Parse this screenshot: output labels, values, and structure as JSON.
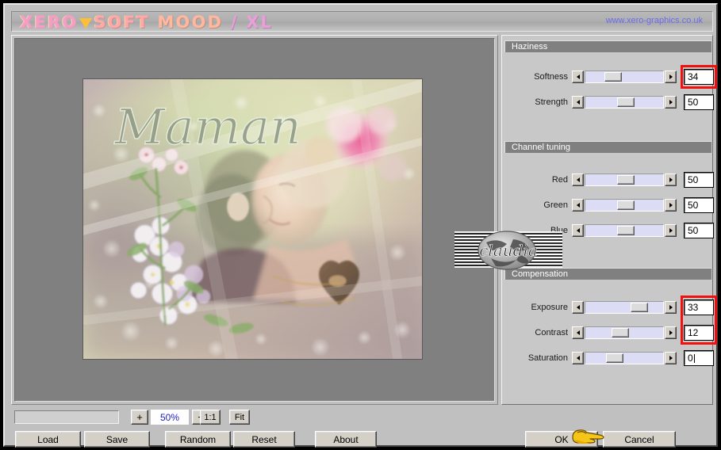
{
  "window": {
    "title_parts": [
      "XERO",
      "SOFT",
      "MOOD",
      "/ XL"
    ],
    "site_url": "www.xero-graphics.co.uk",
    "triangle_icon": "triangle-down-icon"
  },
  "preview": {
    "artwork_caption": "Maman",
    "background_color": "#808080"
  },
  "zoom_bar": {
    "plus_label": "+",
    "zoom_level": "50%",
    "minus_label": "−",
    "one_to_one_label": "1:1",
    "fit_label": "Fit",
    "progress_value": ""
  },
  "actions": {
    "load_label": "Load",
    "save_label": "Save",
    "random_label": "Random",
    "reset_label": "Reset",
    "about_label": "About",
    "ok_label": "OK",
    "cancel_label": "Cancel"
  },
  "groups": [
    {
      "title": "Haziness",
      "rows": [
        {
          "label": "Softness",
          "value": "34",
          "thumb_pct": 34,
          "highlighted": true
        },
        {
          "label": "Strength",
          "value": "50",
          "thumb_pct": 50,
          "highlighted": false
        }
      ]
    },
    {
      "title": "Channel tuning",
      "rows": [
        {
          "label": "Red",
          "value": "50",
          "thumb_pct": 50,
          "highlighted": false
        },
        {
          "label": "Green",
          "value": "50",
          "thumb_pct": 50,
          "highlighted": false
        },
        {
          "label": "Blue",
          "value": "50",
          "thumb_pct": 50,
          "highlighted": false
        }
      ]
    },
    {
      "title": "Compensation",
      "rows": [
        {
          "label": "Exposure",
          "value": "33",
          "thumb_pct": 66,
          "highlighted": true
        },
        {
          "label": "Contrast",
          "value": "12",
          "thumb_pct": 44,
          "highlighted": true
        },
        {
          "label": "Saturation",
          "value": "0",
          "thumb_pct": 36,
          "highlighted": false,
          "caret": true
        }
      ]
    }
  ],
  "watermark": {
    "text": "claudia"
  },
  "cursor": {
    "name": "pointing-hand-cursor",
    "color": "#f5c518"
  },
  "colors": {
    "accent_red": "#f01010",
    "slider_track": "#dcdcf4",
    "panel_header": "#808080",
    "face": "#c8c8c8",
    "zoom_text": "#2222c8",
    "url_text": "#6a6af0"
  }
}
